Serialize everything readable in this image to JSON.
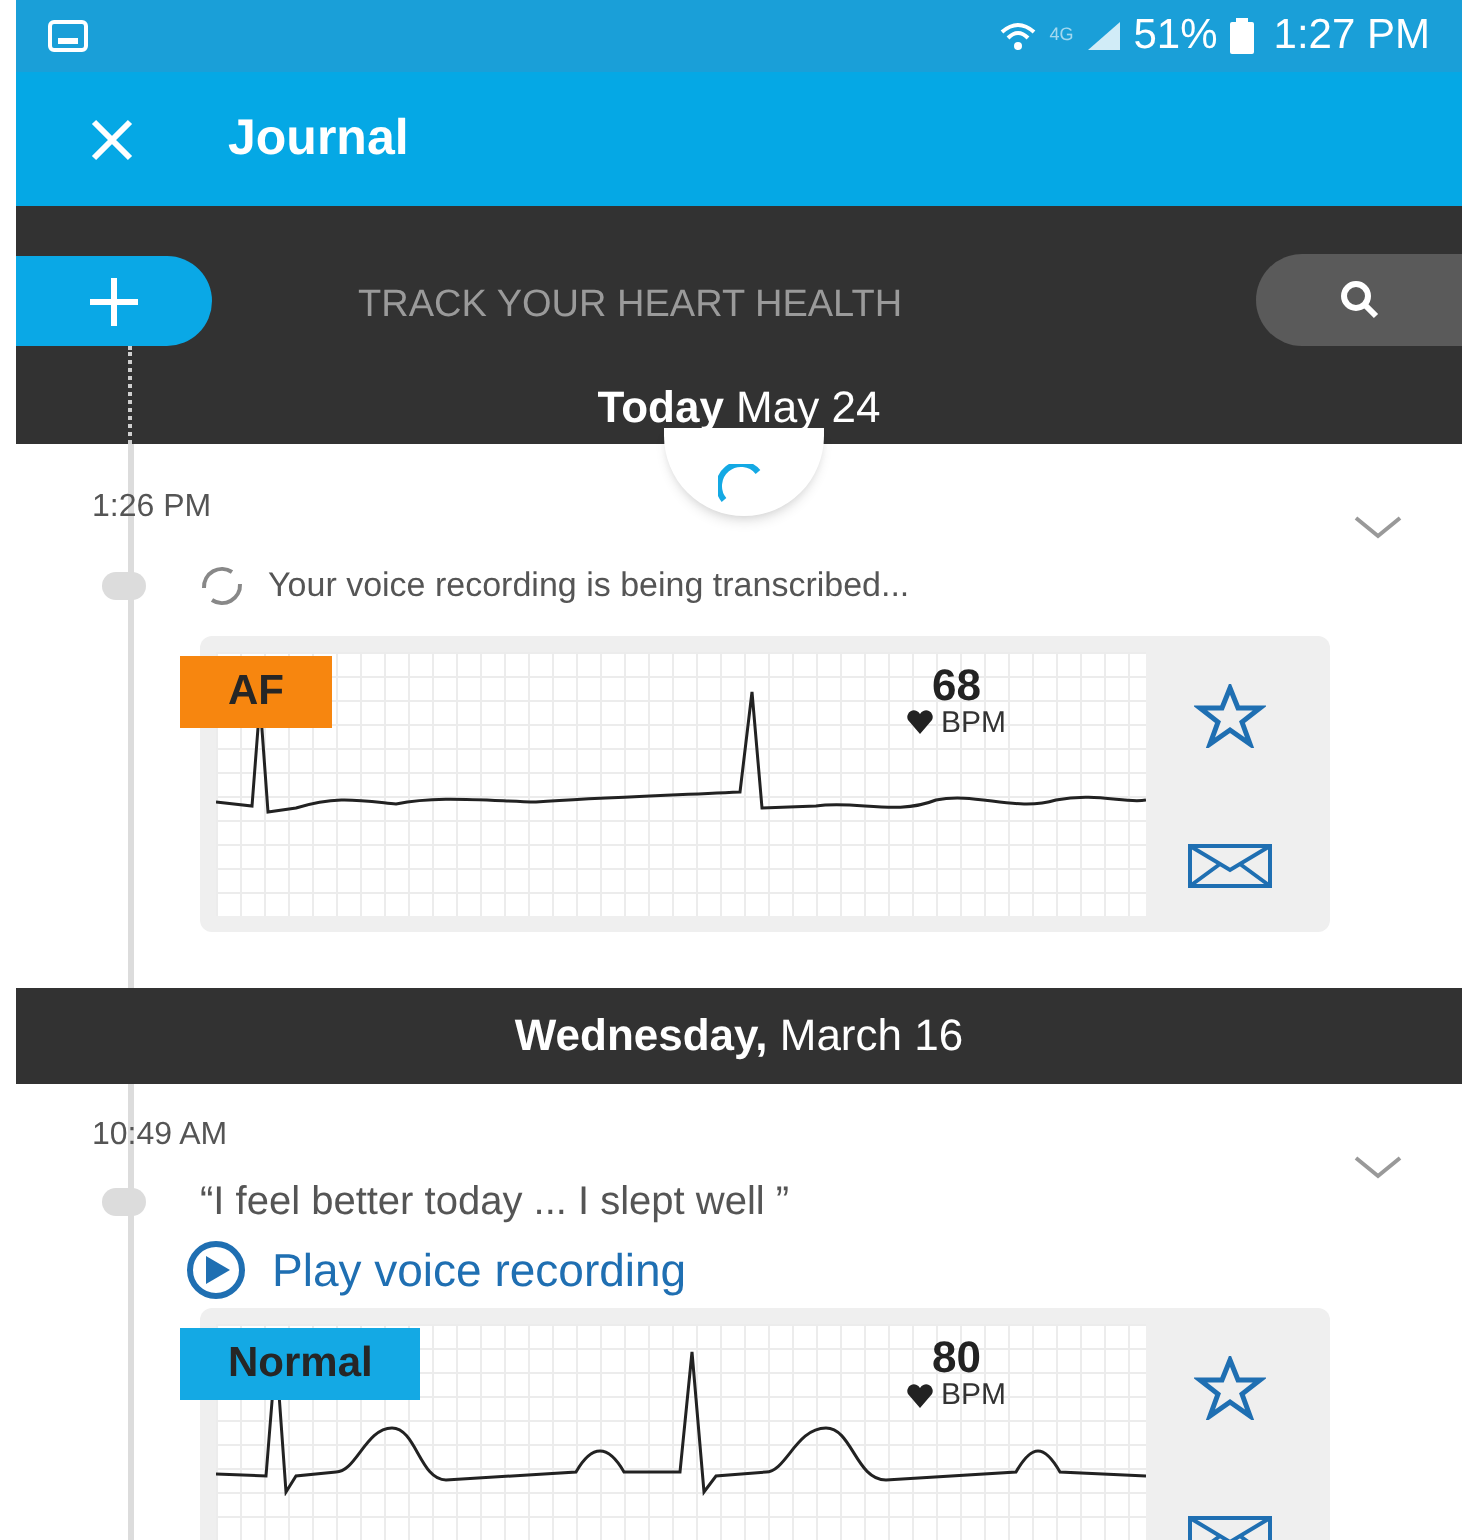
{
  "status_bar": {
    "network": "4G",
    "battery": "51%",
    "time": "1:27 PM"
  },
  "app_bar": {
    "title": "Journal"
  },
  "banner": {
    "tagline": "TRACK YOUR HEART HEALTH"
  },
  "days": [
    {
      "date": "**Today** May 24",
      "entries": [
        {
          "time": "1:26 PM",
          "note": {
            "kind": "status",
            "text": "Your voice recording is being transcribed..."
          },
          "reading": {
            "label": "AF",
            "color": "#f7860f",
            "bpm": "68",
            "unit": "BPM"
          }
        }
      ]
    },
    {
      "date": "**Wednesday,** March 16",
      "entries": [
        {
          "time": "10:49 AM",
          "note": {
            "kind": "quote",
            "text": "“I feel better today ... I slept well ”",
            "link": "Play voice recording"
          },
          "reading": {
            "label": "Normal",
            "color": "#14a9e4",
            "bpm": "80",
            "unit": "BPM"
          }
        }
      ]
    }
  ]
}
